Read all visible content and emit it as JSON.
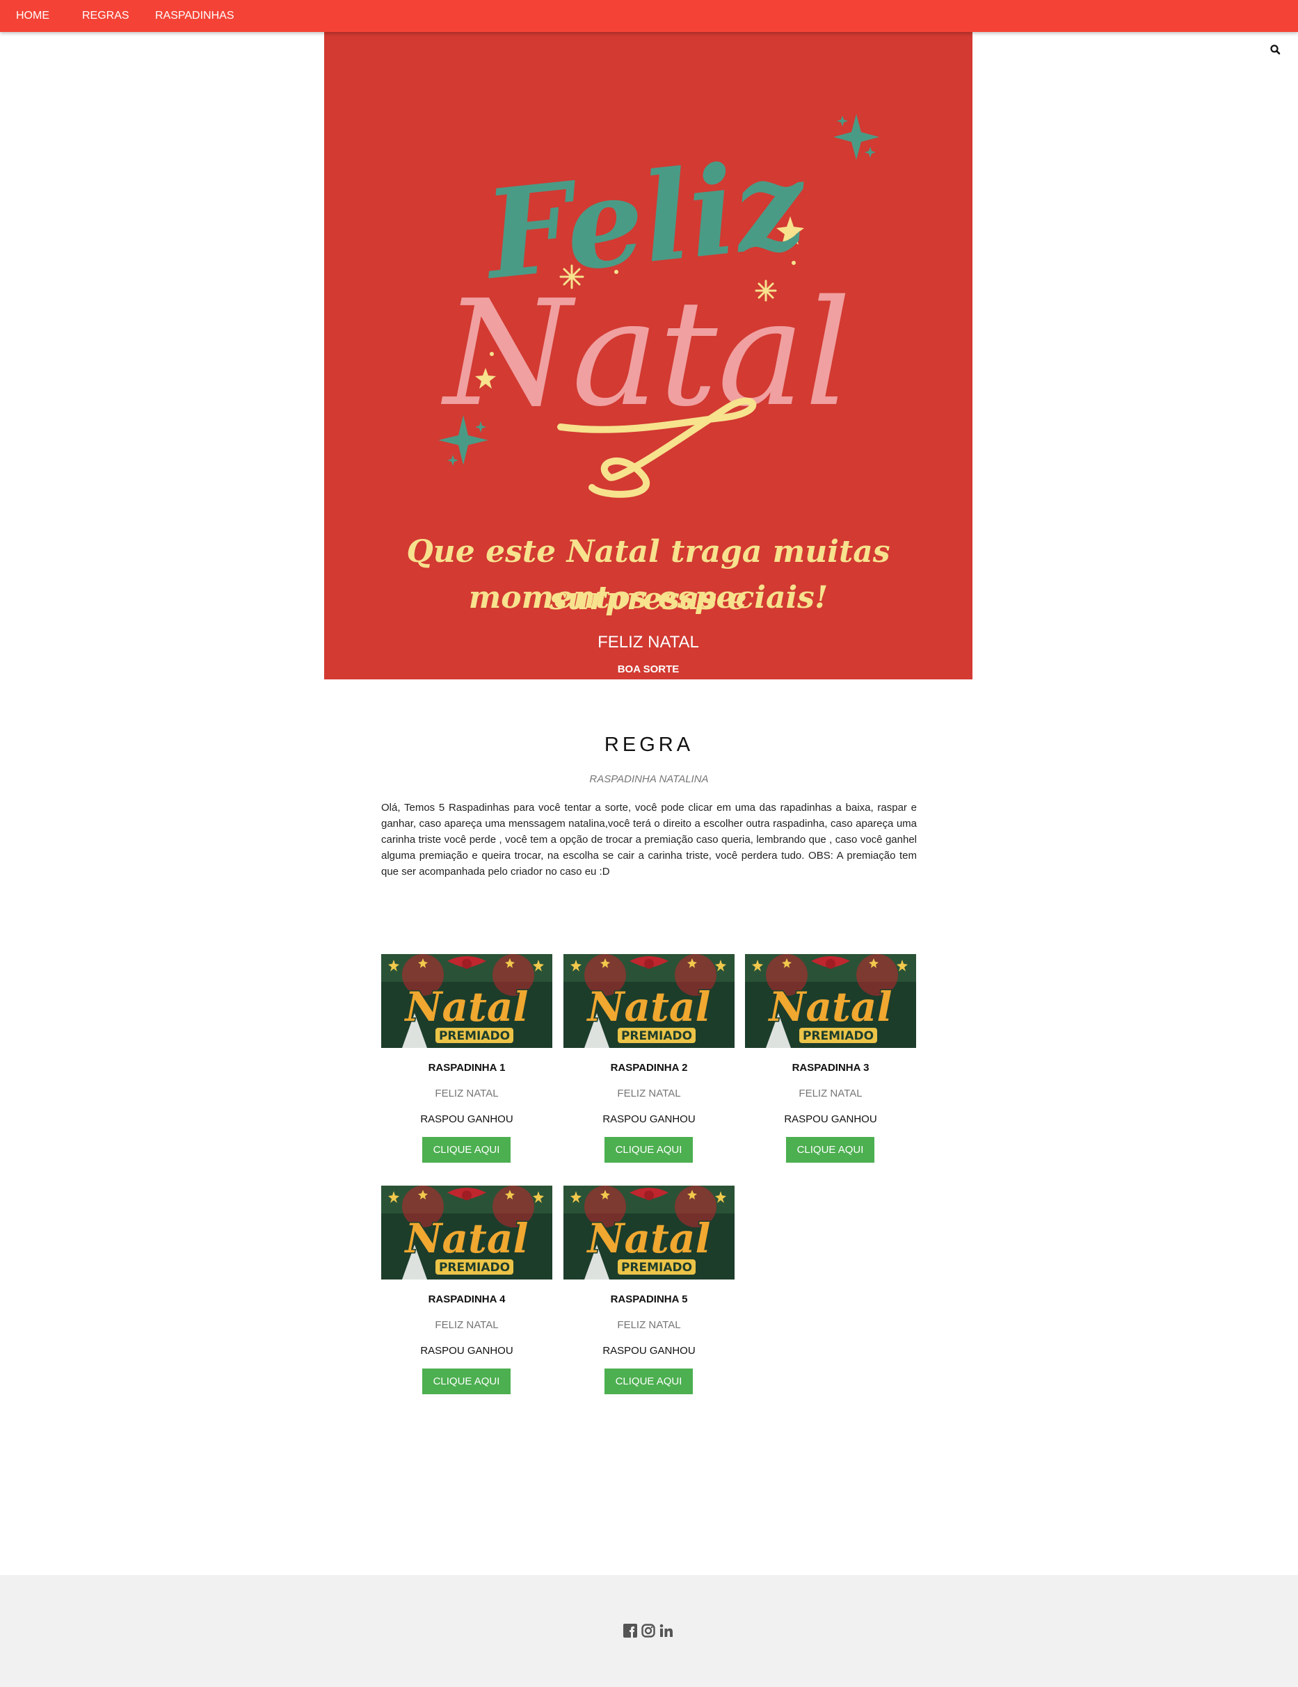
{
  "nav": {
    "items": [
      "HOME",
      "REGRAS",
      "RASPADINHAS"
    ]
  },
  "icons": {
    "search": "search-icon",
    "facebook": "facebook-icon",
    "instagram": "instagram-icon",
    "linkedin": "linkedin-icon"
  },
  "hero": {
    "title_line1": "Feliz",
    "title_line2": "Natal",
    "tagline_line1": "Que este Natal traga muitas surpresas e",
    "tagline_line2": "momentos especiais!",
    "caption": "FELIZ NATAL",
    "subcaption": "BOA SORTE"
  },
  "rules": {
    "title": "REGRA",
    "subtitle": "RASPADINHA NATALINA",
    "text": "Olá, Temos 5 Raspadinhas para você tentar a sorte, você pode clicar em uma das rapadinhas a baixa, raspar e ganhar, caso apareça uma menssagem natalina,você terá o direito a escolher outra raspadinha, caso apareça uma carinha triste você perde , você tem a opção de trocar a premiação caso queria, lembrando que , caso você ganhel alguma premiação e queira trocar, na escolha se cair a carinha triste, você perdera tudo. OBS: A premiação tem que ser acompanhada pelo criador no caso eu :D"
  },
  "cards": [
    {
      "image_title": "Natal",
      "image_badge": "PREMIADO",
      "name": "RASPADINHA 1",
      "subtitle": "FELIZ NATAL",
      "text": "RASPOU GANHOU",
      "button": "CLIQUE AQUI"
    },
    {
      "image_title": "Natal",
      "image_badge": "PREMIADO",
      "name": "RASPADINHA 2",
      "subtitle": "FELIZ NATAL",
      "text": "RASPOU GANHOU",
      "button": "CLIQUE AQUI"
    },
    {
      "image_title": "Natal",
      "image_badge": "PREMIADO",
      "name": "RASPADINHA 3",
      "subtitle": "FELIZ NATAL",
      "text": "RASPOU GANHOU",
      "button": "CLIQUE AQUI"
    },
    {
      "image_title": "Natal",
      "image_badge": "PREMIADO",
      "name": "RASPADINHA 4",
      "subtitle": "FELIZ NATAL",
      "text": "RASPOU GANHOU",
      "button": "CLIQUE AQUI"
    },
    {
      "image_title": "Natal",
      "image_badge": "PREMIADO",
      "name": "RASPADINHA 5",
      "subtitle": "FELIZ NATAL",
      "text": "RASPOU GANHOU",
      "button": "CLIQUE AQUI"
    }
  ],
  "colors": {
    "nav_bg": "#f44336",
    "hero_bg": "#d23a32",
    "button_bg": "#4caf50",
    "footer_bg": "#f1f1f1",
    "title_teal": "#4a9b86",
    "title_pink": "#f0a0a0",
    "accent_gold": "#f7e28e"
  }
}
